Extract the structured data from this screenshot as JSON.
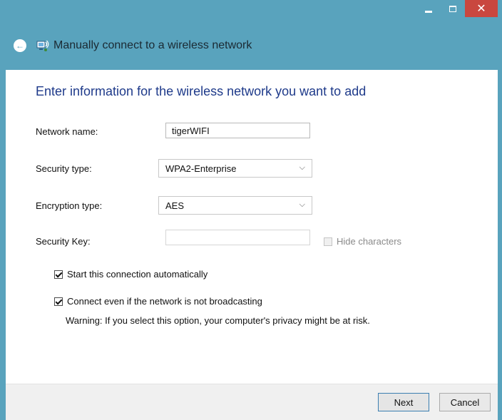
{
  "window": {
    "title": "Manually connect to a wireless network",
    "controls": {
      "close_glyph": "✕"
    },
    "colors": {
      "chrome": "#59a3bd",
      "close": "#c9473f",
      "heading": "#1e3a8a"
    }
  },
  "page": {
    "heading": "Enter information for the wireless network you want to add",
    "fields": {
      "network_name": {
        "label": "Network name:",
        "value": "tigerWIFI"
      },
      "security_type": {
        "label": "Security type:",
        "value": "WPA2-Enterprise"
      },
      "encryption_type": {
        "label": "Encryption type:",
        "value": "AES"
      },
      "security_key": {
        "label": "Security Key:",
        "value": "",
        "hide_label": "Hide characters"
      }
    },
    "options": {
      "start_auto": {
        "label": "Start this connection automatically",
        "checked": true
      },
      "connect_even": {
        "label": "Connect even if the network is not broadcasting",
        "checked": true
      }
    },
    "warning": "Warning: If you select this option, your computer's privacy might be at risk."
  },
  "footer": {
    "next_label": "Next",
    "cancel_label": "Cancel"
  },
  "icons": {
    "back": "back-arrow-icon",
    "network": "wireless-network-icon",
    "chevron": "chevron-down-icon"
  }
}
